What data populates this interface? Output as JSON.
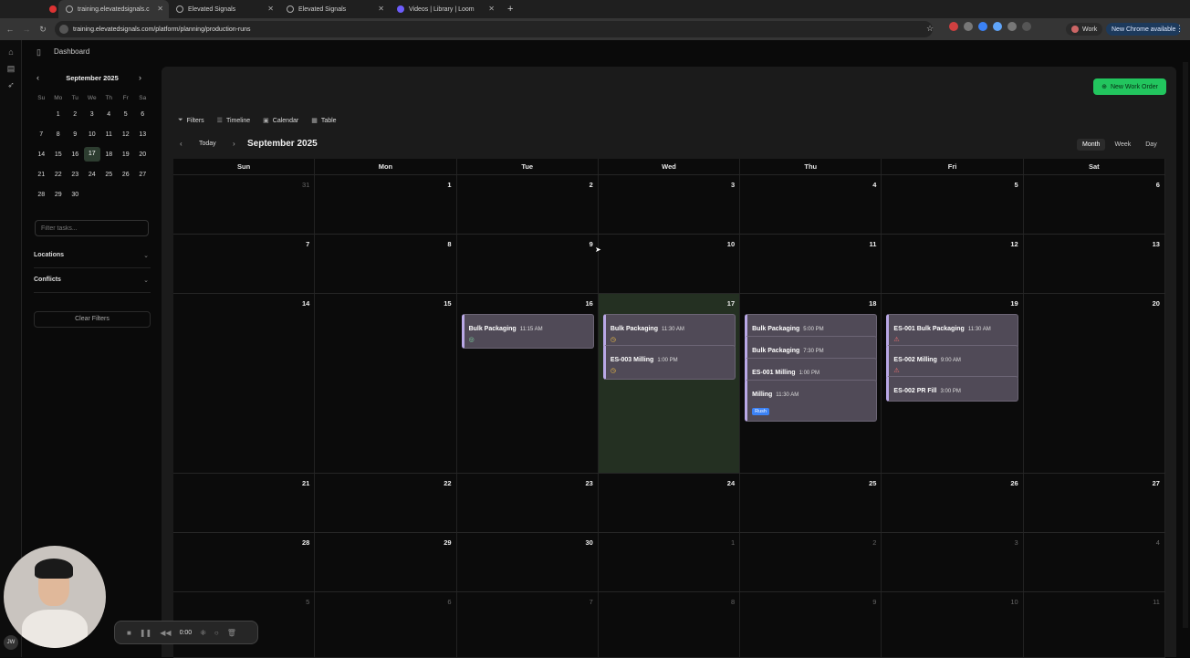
{
  "browser": {
    "tabs": [
      {
        "label": "training.elevatedsignals.c",
        "active": true
      },
      {
        "label": "Elevated Signals",
        "active": false
      },
      {
        "label": "Elevated Signals",
        "active": false
      },
      {
        "label": "Videos | Library | Loom",
        "active": false
      }
    ],
    "url": "training.elevatedsignals.com/platform/planning/production-runs",
    "profile_label": "Work",
    "update_label": "New Chrome available"
  },
  "header": {
    "breadcrumb": "Dashboard"
  },
  "mini_calendar": {
    "title": "September 2025",
    "weekdays": [
      "Su",
      "Mo",
      "Tu",
      "We",
      "Th",
      "Fr",
      "Sa"
    ],
    "weeks": [
      [
        "",
        "1",
        "2",
        "3",
        "4",
        "5",
        "6"
      ],
      [
        "7",
        "8",
        "9",
        "10",
        "11",
        "12",
        "13"
      ],
      [
        "14",
        "15",
        "16",
        "17",
        "18",
        "19",
        "20"
      ],
      [
        "21",
        "22",
        "23",
        "24",
        "25",
        "26",
        "27"
      ],
      [
        "28",
        "29",
        "30",
        "",
        "",
        "",
        ""
      ]
    ],
    "selected": "17"
  },
  "sidebar": {
    "filter_placeholder": "Filter tasks...",
    "locations_label": "Locations",
    "conflicts_label": "Conflicts",
    "clear_label": "Clear Filters"
  },
  "toolbar": {
    "new_work_order": "New Work Order",
    "views": [
      "Filters",
      "Timeline",
      "Calendar",
      "Table"
    ],
    "today": "Today",
    "month_title": "September 2025",
    "modes": [
      "Month",
      "Week",
      "Day"
    ],
    "active_mode": "Month"
  },
  "calendar": {
    "weekdays": [
      "Sun",
      "Mon",
      "Tue",
      "Wed",
      "Thu",
      "Fri",
      "Sat"
    ],
    "weeks": [
      {
        "days": [
          {
            "n": "31",
            "out": true
          },
          {
            "n": "1"
          },
          {
            "n": "2"
          },
          {
            "n": "3"
          },
          {
            "n": "4"
          },
          {
            "n": "5"
          },
          {
            "n": "6"
          }
        ]
      },
      {
        "days": [
          {
            "n": "7"
          },
          {
            "n": "8"
          },
          {
            "n": "9"
          },
          {
            "n": "10"
          },
          {
            "n": "11"
          },
          {
            "n": "12"
          },
          {
            "n": "13"
          }
        ]
      },
      {
        "days": [
          {
            "n": "14"
          },
          {
            "n": "15"
          },
          {
            "n": "16",
            "events": [
              {
                "title": "Bulk Packaging",
                "time": "11:15 AM",
                "icon": "ok"
              }
            ]
          },
          {
            "n": "17",
            "today": true,
            "events": [
              {
                "title": "Bulk Packaging",
                "time": "11:30 AM",
                "icon": "clock"
              },
              {
                "title": "ES-003 Milling",
                "time": "1:00 PM",
                "icon": "clock"
              }
            ]
          },
          {
            "n": "18",
            "events": [
              {
                "title": "Bulk Packaging",
                "time": "5:00 PM"
              },
              {
                "title": "Bulk Packaging",
                "time": "7:30 PM"
              },
              {
                "title": "ES-001 Milling",
                "time": "1:00 PM"
              },
              {
                "title": "Milling",
                "time": "11:30 AM",
                "badge": "Rush"
              }
            ]
          },
          {
            "n": "19",
            "events": [
              {
                "title": "ES-001 Bulk Packaging",
                "time": "11:30 AM",
                "icon": "warn"
              },
              {
                "title": "ES-002 Milling",
                "time": "9:00 AM",
                "icon": "warn"
              },
              {
                "title": "ES-002 PR Fill",
                "time": "3:00 PM"
              }
            ]
          },
          {
            "n": "20"
          }
        ]
      },
      {
        "days": [
          {
            "n": "21"
          },
          {
            "n": "22"
          },
          {
            "n": "23"
          },
          {
            "n": "24"
          },
          {
            "n": "25"
          },
          {
            "n": "26"
          },
          {
            "n": "27"
          }
        ]
      },
      {
        "days": [
          {
            "n": "28"
          },
          {
            "n": "29"
          },
          {
            "n": "30"
          },
          {
            "n": "1",
            "out": true
          },
          {
            "n": "2",
            "out": true
          },
          {
            "n": "3",
            "out": true
          },
          {
            "n": "4",
            "out": true
          }
        ]
      },
      {
        "days": [
          {
            "n": "5",
            "out": true
          },
          {
            "n": "6",
            "out": true
          },
          {
            "n": "7",
            "out": true
          },
          {
            "n": "8",
            "out": true
          },
          {
            "n": "9",
            "out": true
          },
          {
            "n": "10",
            "out": true
          },
          {
            "n": "11",
            "out": true
          }
        ]
      }
    ]
  },
  "recorder": {
    "time": "0:00",
    "initials": "JW"
  },
  "colors": {
    "accent_green": "#22c55e",
    "event_bg": "#504a57",
    "today_bg": "#243022"
  }
}
